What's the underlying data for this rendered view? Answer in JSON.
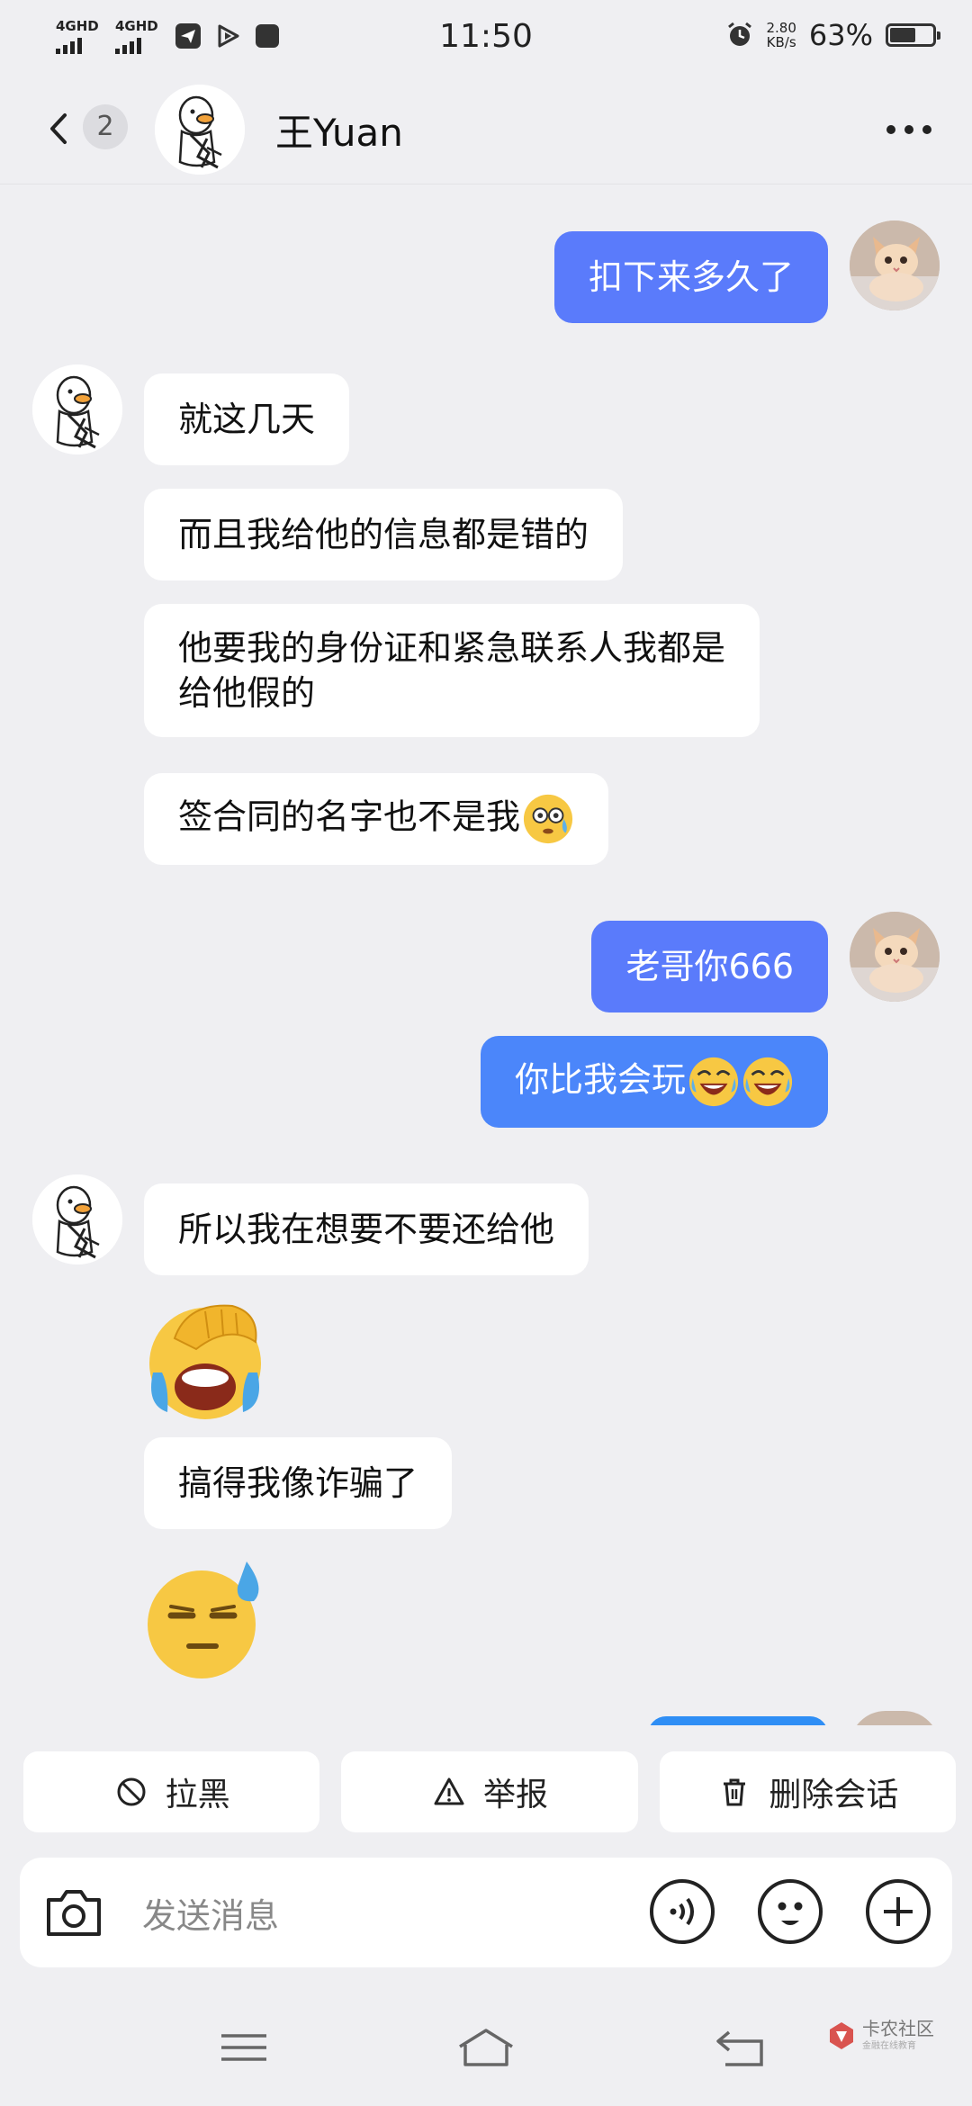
{
  "status_bar": {
    "sim1_label": "4GHD",
    "sim2_label": "4GHD",
    "time": "11:50",
    "net_speed_value": "2.80",
    "net_speed_unit": "KB/s",
    "battery_text": "63%",
    "battery_level": 0.63
  },
  "header": {
    "unread_count": "2",
    "contact_name": "王Yuan"
  },
  "messages": [
    {
      "from": "me",
      "text": "扣下来多久了"
    },
    {
      "from": "them",
      "text": "就这几天"
    },
    {
      "from": "them",
      "text": "而且我给他的信息都是错的"
    },
    {
      "from": "them",
      "text_line1": "他要我的身份证和紧急联系人我都是",
      "text_line2": "给他假的"
    },
    {
      "from": "them",
      "text": "签合同的名字也不是我",
      "emoji": "flushed-face-emoji"
    },
    {
      "from": "me",
      "text": "老哥你666"
    },
    {
      "from": "me",
      "text": "你比我会玩",
      "emoji": "rolling-laughing-emoji x2"
    },
    {
      "from": "them",
      "text": "所以我在想要不要还给他"
    },
    {
      "from": "them",
      "sticker": "facepalm-crying-sticker"
    },
    {
      "from": "them",
      "text": "搞得我像诈骗了"
    },
    {
      "from": "them",
      "sticker": "sweat-expressionless-sticker"
    }
  ],
  "actions": {
    "block_label": "拉黑",
    "report_label": "举报",
    "delete_label": "删除会话"
  },
  "input": {
    "placeholder": "发送消息"
  },
  "watermark": {
    "brand": "卡农社区",
    "tagline": "金融在线教育"
  },
  "colors": {
    "outgoing_bubble": "#5a7bfb",
    "incoming_bubble": "#ffffff",
    "background": "#efeff2"
  }
}
